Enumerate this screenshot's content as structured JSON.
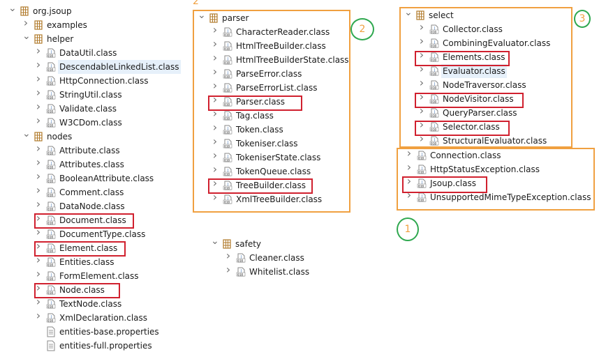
{
  "colors": {
    "package": "#b07a2a",
    "class": "#3d6fb6",
    "annotation_box": "#f0a040",
    "highlight_box": "#d0202e",
    "circle": "#2fa84f"
  },
  "icons": {
    "package": "package-icon",
    "class": "class-file-icon",
    "properties": "properties-file-icon"
  },
  "left_tree": {
    "root": "org.jsoup",
    "examples": "examples",
    "helper": "helper",
    "helper_items": [
      "DataUtil.class",
      "DescendableLinkedList.class",
      "HttpConnection.class",
      "StringUtil.class",
      "Validate.class",
      "W3CDom.class"
    ],
    "nodes": "nodes",
    "nodes_items": [
      "Attribute.class",
      "Attributes.class",
      "BooleanAttribute.class",
      "Comment.class",
      "DataNode.class",
      "Document.class",
      "DocumentType.class",
      "Element.class",
      "Entities.class",
      "FormElement.class",
      "Node.class",
      "TextNode.class",
      "XmlDeclaration.class"
    ],
    "properties_items": [
      "entities-base.properties",
      "entities-full.properties"
    ]
  },
  "parser_tree": {
    "label": "parser",
    "items": [
      "CharacterReader.class",
      "HtmlTreeBuilder.class",
      "HtmlTreeBuilderState.class",
      "ParseError.class",
      "ParseErrorList.class",
      "Parser.class",
      "Tag.class",
      "Token.class",
      "Tokeniser.class",
      "TokeniserState.class",
      "TokenQueue.class",
      "TreeBuilder.class",
      "XmlTreeBuilder.class"
    ]
  },
  "safety_tree": {
    "label": "safety",
    "items": [
      "Cleaner.class",
      "Whitelist.class"
    ]
  },
  "select_tree": {
    "label": "select",
    "items": [
      "Collector.class",
      "CombiningEvaluator.class",
      "Elements.class",
      "Evaluator.class",
      "NodeTraversor.class",
      "NodeVisitor.class",
      "QueryParser.class",
      "Selector.class",
      "StructuralEvaluator.class"
    ]
  },
  "root_classes": [
    "Connection.class",
    "HttpStatusException.class",
    "Jsoup.class",
    "UnsupportedMimeTypeException.class"
  ],
  "annotations": {
    "badge_parser": "2",
    "circle_parser": "2",
    "circle_select": "3",
    "circle_root": "1"
  }
}
